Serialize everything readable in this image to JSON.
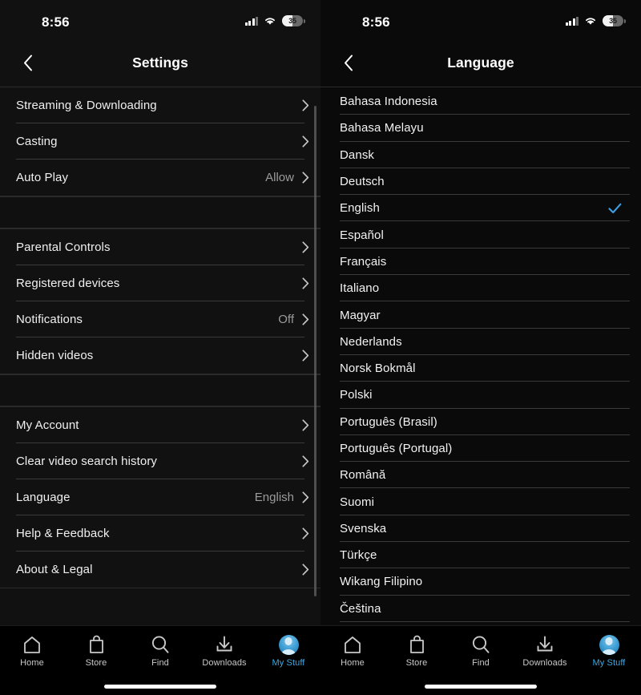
{
  "status_bar": {
    "time": "8:56",
    "battery_percent": "35",
    "signal_icon": "cellular-signal-icon",
    "wifi_icon": "wifi-icon",
    "battery_icon": "battery-icon"
  },
  "colors": {
    "background": "#0b0b0b",
    "panel": "#111111",
    "separator": "#3a3a3a",
    "text_primary": "#f0f0f0",
    "text_secondary": "#9b9b9b",
    "accent": "#3fa8e0",
    "check_blue": "#3b9fe0"
  },
  "left_pane": {
    "nav": {
      "back_icon": "chevron-left-icon",
      "title": "Settings"
    },
    "sections": [
      {
        "rows": [
          {
            "label": "Streaming & Downloading",
            "value": "",
            "chevron": true
          },
          {
            "label": "Casting",
            "value": "",
            "chevron": true
          },
          {
            "label": "Auto Play",
            "value": "Allow",
            "chevron": true
          }
        ]
      },
      {
        "rows": [
          {
            "label": "Parental Controls",
            "value": "",
            "chevron": true
          },
          {
            "label": "Registered devices",
            "value": "",
            "chevron": true
          },
          {
            "label": "Notifications",
            "value": "Off",
            "chevron": true
          },
          {
            "label": "Hidden videos",
            "value": "",
            "chevron": true
          }
        ]
      },
      {
        "rows": [
          {
            "label": "My Account",
            "value": "",
            "chevron": true
          },
          {
            "label": "Clear video search history",
            "value": "",
            "chevron": true
          },
          {
            "label": "Language",
            "value": "English",
            "chevron": true
          },
          {
            "label": "Help & Feedback",
            "value": "",
            "chevron": true
          },
          {
            "label": "About & Legal",
            "value": "",
            "chevron": true
          }
        ]
      }
    ]
  },
  "right_pane": {
    "nav": {
      "back_icon": "chevron-left-icon",
      "title": "Language"
    },
    "selected_language": "English",
    "languages": [
      {
        "label": "Bahasa Indonesia",
        "selected": false
      },
      {
        "label": "Bahasa Melayu",
        "selected": false
      },
      {
        "label": "Dansk",
        "selected": false
      },
      {
        "label": "Deutsch",
        "selected": false
      },
      {
        "label": "English",
        "selected": true
      },
      {
        "label": "Español",
        "selected": false
      },
      {
        "label": "Français",
        "selected": false
      },
      {
        "label": "Italiano",
        "selected": false
      },
      {
        "label": "Magyar",
        "selected": false
      },
      {
        "label": "Nederlands",
        "selected": false
      },
      {
        "label": "Norsk Bokmål",
        "selected": false
      },
      {
        "label": "Polski",
        "selected": false
      },
      {
        "label": "Português (Brasil)",
        "selected": false
      },
      {
        "label": "Português (Portugal)",
        "selected": false
      },
      {
        "label": "Română",
        "selected": false
      },
      {
        "label": "Suomi",
        "selected": false
      },
      {
        "label": "Svenska",
        "selected": false
      },
      {
        "label": "Türkçe",
        "selected": false
      },
      {
        "label": "Wikang Filipino",
        "selected": false
      },
      {
        "label": "Čeština",
        "selected": false
      }
    ]
  },
  "tab_bar": {
    "active": "My Stuff",
    "tabs": [
      {
        "label": "Home",
        "icon": "home-icon"
      },
      {
        "label": "Store",
        "icon": "shopping-bag-icon"
      },
      {
        "label": "Find",
        "icon": "search-icon"
      },
      {
        "label": "Downloads",
        "icon": "download-icon"
      },
      {
        "label": "My Stuff",
        "icon": "avatar-icon"
      }
    ]
  }
}
